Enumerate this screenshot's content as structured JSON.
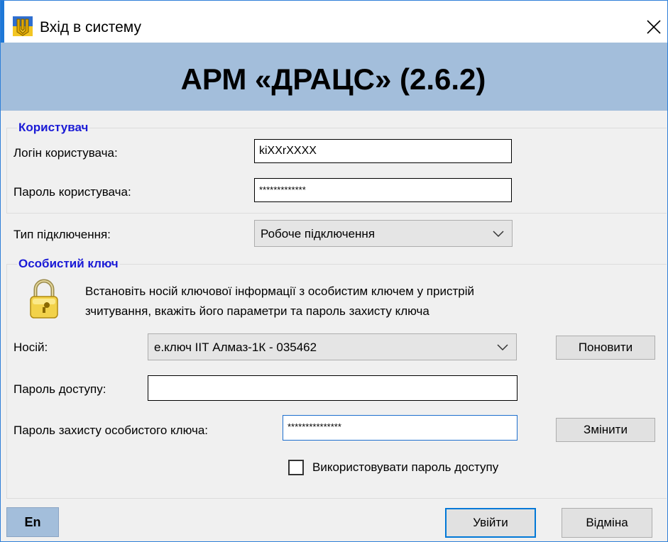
{
  "window": {
    "title": "Вхід в систему",
    "app_icon": "ukraine-coat-of-arms-icon",
    "close_icon": "close-icon"
  },
  "banner": {
    "title": "АРМ «ДРАЦС» (2.6.2)"
  },
  "user_group": {
    "title": "Користувач",
    "login_label": "Логін користувача:",
    "login_value": "kiXXrXXXX",
    "password_label": "Пароль користувача:",
    "password_value": "*************"
  },
  "connection": {
    "label": "Тип підключення:",
    "selected": "Робоче підключення"
  },
  "key_group": {
    "title": "Особистий ключ",
    "lock_icon": "lock-icon",
    "instruction_line1": "Встановіть носій ключової інформації з особистим ключем у пристрій",
    "instruction_line2": "зчитування, вкажіть його параметри та пароль захисту ключа",
    "media_label": "Носій:",
    "media_selected": "е.ключ ІІТ Алмаз-1К - 035462",
    "refresh_button": "Поновити",
    "access_password_label": "Пароль доступу:",
    "access_password_value": "",
    "key_password_label": "Пароль захисту особистого ключа:",
    "key_password_value": "***************",
    "change_button": "Змінити",
    "use_access_password_label": "Використовувати пароль доступу",
    "use_access_password_checked": false
  },
  "footer": {
    "language_button": "En",
    "login_button": "Увійти",
    "cancel_button": "Відміна"
  },
  "colors": {
    "banner_bg": "#a3bedb",
    "group_title": "#1a1ad6",
    "client_bg": "#f0f0f0",
    "accent": "#0078d7"
  }
}
